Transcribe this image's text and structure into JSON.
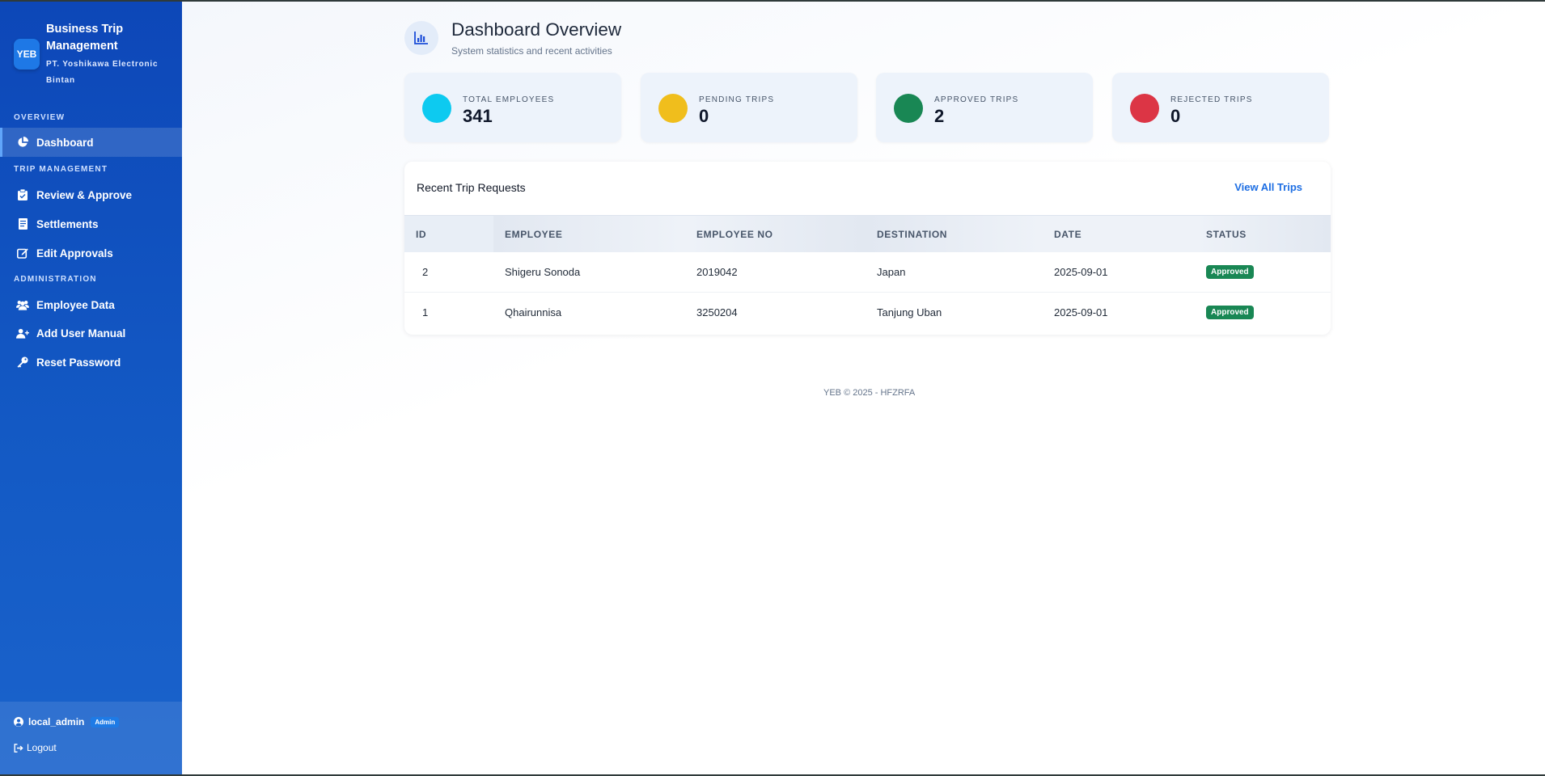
{
  "brand": {
    "logo": "YEB",
    "title": "Business Trip Management",
    "subtitle": "PT. Yoshikawa Electronic Bintan"
  },
  "sidebar": {
    "sections": {
      "overview": "OVERVIEW",
      "trip": "TRIP MANAGEMENT",
      "admin": "ADMINISTRATION"
    },
    "items": [
      {
        "label": "Dashboard",
        "icon": "chart-pie-icon",
        "active": true
      },
      {
        "label": "Review & Approve",
        "icon": "clipboard-icon"
      },
      {
        "label": "Settlements",
        "icon": "receipt-icon"
      },
      {
        "label": "Edit Approvals",
        "icon": "edit-icon"
      },
      {
        "label": "Employee Data",
        "icon": "users-icon"
      },
      {
        "label": "Add User Manual",
        "icon": "user-plus-icon"
      },
      {
        "label": "Reset Password",
        "icon": "key-icon"
      }
    ]
  },
  "user": {
    "name": "local_admin",
    "role": "Admin",
    "logout": "Logout"
  },
  "header": {
    "title": "Dashboard Overview",
    "subtitle": "System statistics and recent activities"
  },
  "stats": [
    {
      "label": "TOTAL EMPLOYEES",
      "value": "341",
      "color": "#0dcaf0"
    },
    {
      "label": "PENDING TRIPS",
      "value": "0",
      "color": "#f0be1c"
    },
    {
      "label": "APPROVED TRIPS",
      "value": "2",
      "color": "#198754"
    },
    {
      "label": "REJECTED TRIPS",
      "value": "0",
      "color": "#dc3545"
    }
  ],
  "recent": {
    "title": "Recent Trip Requests",
    "view_all": "View All Trips",
    "columns": [
      "ID",
      "EMPLOYEE",
      "EMPLOYEE NO",
      "DESTINATION",
      "DATE",
      "STATUS"
    ],
    "rows": [
      [
        "2",
        "Shigeru Sonoda",
        "2019042",
        "Japan",
        "2025-09-01",
        "Approved"
      ],
      [
        "1",
        "Qhairunnisa",
        "3250204",
        "Tanjung Uban",
        "2025-09-01",
        "Approved"
      ]
    ]
  },
  "footer": "YEB © 2025 - HFZRFA",
  "colors": {
    "sidebar": "#0d47b8",
    "accent": "#1d6ee3",
    "approved": "#198754"
  }
}
